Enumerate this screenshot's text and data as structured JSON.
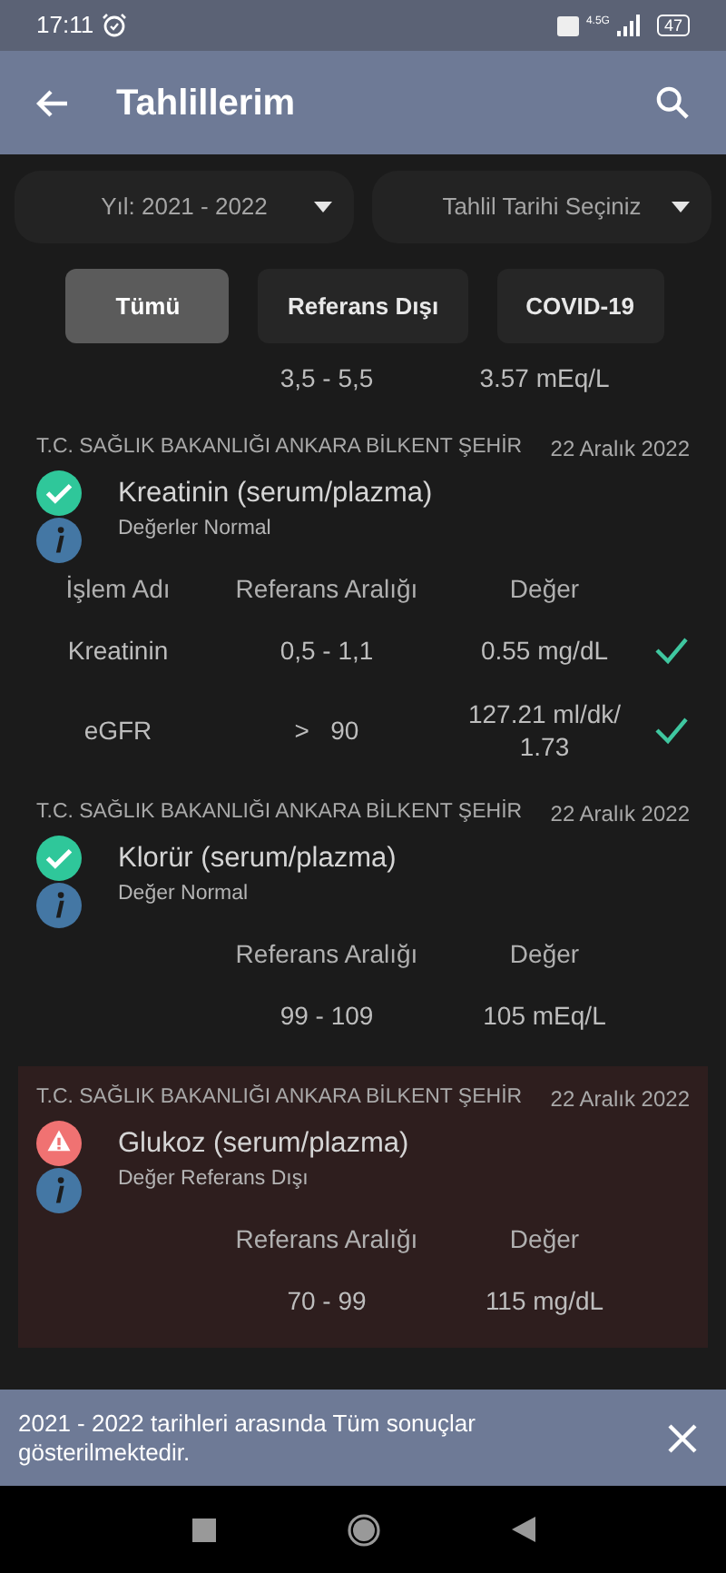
{
  "status_bar": {
    "time": "17:11",
    "network": "4.5G",
    "battery": "47"
  },
  "app_bar": {
    "title": "Tahlillerim"
  },
  "filters": [
    {
      "label": "Yıl: 2021 - 2022"
    },
    {
      "label": "Tahlil Tarihi Seçiniz"
    }
  ],
  "chips": [
    {
      "label": "Tümü",
      "selected": true
    },
    {
      "label": "Referans Dışı",
      "selected": false
    },
    {
      "label": "COVID-19",
      "selected": false
    }
  ],
  "partial_row": {
    "range": "3,5 - 5,5",
    "value": "3.57 mEq/L"
  },
  "results": [
    {
      "hospital": "T.C. SAĞLIK BAKANLIĞI ANKARA BİLKENT ŞEHİR",
      "date": "22 Aralık 2022",
      "title": "Kreatinin (serum/plazma)",
      "kind": "normal",
      "summary": "Değerler Normal",
      "columns": [
        "İşlem Adı",
        "Referans Aralığı",
        "Değer"
      ],
      "rows": [
        {
          "name": "Kreatinin",
          "range": "0,5 - 1,1",
          "value": "0.55 mg/dL",
          "ok": true
        },
        {
          "name": "eGFR",
          "range": ">   90",
          "value": "127.21 ml/dk/ 1.73",
          "ok": true
        }
      ]
    },
    {
      "hospital": "T.C. SAĞLIK BAKANLIĞI ANKARA BİLKENT ŞEHİR",
      "date": "22 Aralık 2022",
      "title": "Klorür (serum/plazma)",
      "kind": "normal",
      "summary": "Değer Normal",
      "columns": [
        "Referans Aralığı",
        "Değer"
      ],
      "rows": [
        {
          "range": "99 - 109",
          "value": "105 mEq/L",
          "ok": false
        }
      ]
    },
    {
      "hospital": "T.C. SAĞLIK BAKANLIĞI ANKARA BİLKENT ŞEHİR",
      "date": "22 Aralık 2022",
      "title": "Glukoz (serum/plazma)",
      "kind": "abnormal",
      "summary": "Değer Referans Dışı",
      "columns": [
        "Referans Aralığı",
        "Değer"
      ],
      "rows": [
        {
          "range": "70 - 99",
          "value": "115 mg/dL",
          "ok": false
        }
      ]
    }
  ],
  "snackbar": {
    "message": "2021 - 2022 tarihleri arasında Tüm sonuçlar gösterilmektedir."
  }
}
